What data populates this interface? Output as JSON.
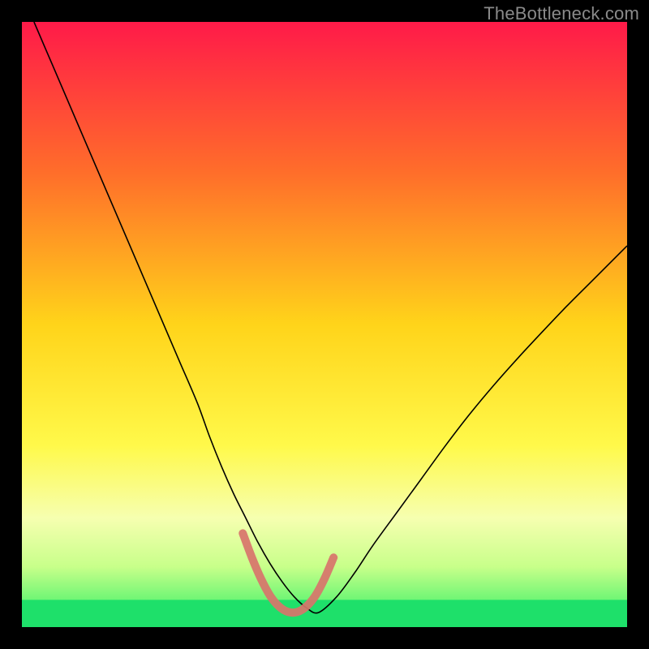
{
  "watermark": "TheBottleneck.com",
  "chart_data": {
    "type": "line",
    "title": "",
    "xlabel": "",
    "ylabel": "",
    "xlim": [
      0,
      100
    ],
    "ylim": [
      0,
      100
    ],
    "grid": false,
    "legend": false,
    "gradient_stops": [
      {
        "offset": 0.0,
        "color": "#ff1a49"
      },
      {
        "offset": 0.25,
        "color": "#ff6e2a"
      },
      {
        "offset": 0.5,
        "color": "#ffd41a"
      },
      {
        "offset": 0.7,
        "color": "#fff94a"
      },
      {
        "offset": 0.82,
        "color": "#f6ffb0"
      },
      {
        "offset": 0.9,
        "color": "#c8ff8a"
      },
      {
        "offset": 0.96,
        "color": "#67f573"
      },
      {
        "offset": 1.0,
        "color": "#1ee06a"
      }
    ],
    "series": [
      {
        "name": "bottleneck-curve",
        "stroke": "#000000",
        "stroke_width": 1.6,
        "x": [
          2,
          5,
          8,
          11,
          14,
          17,
          20,
          23,
          26,
          29,
          31,
          33,
          35,
          37,
          39,
          41,
          43,
          45,
          47,
          49,
          52,
          55,
          58,
          62,
          66,
          70,
          74,
          78,
          82,
          86,
          90,
          94,
          98,
          100
        ],
        "y": [
          100,
          93,
          86,
          79,
          72,
          65,
          58,
          51,
          44,
          37,
          31.5,
          26.5,
          22,
          18,
          14,
          10.5,
          7.5,
          5,
          3.2,
          2.4,
          5,
          9,
          13.5,
          19,
          24.5,
          30,
          35.2,
          40,
          44.5,
          48.8,
          53,
          57,
          61,
          63
        ]
      },
      {
        "name": "optimal-zone-highlight",
        "stroke": "#d8746b",
        "stroke_width": 10,
        "linecap": "round",
        "x": [
          36.5,
          38,
          39.5,
          41,
          42.5,
          44,
          45.5,
          47,
          48.5,
          50,
          51.5
        ],
        "y": [
          15.5,
          11.5,
          8.0,
          5.2,
          3.4,
          2.5,
          2.5,
          3.4,
          5.2,
          8.0,
          11.5
        ]
      }
    ],
    "green_band": {
      "y_from": 0,
      "y_to": 4.5
    }
  }
}
